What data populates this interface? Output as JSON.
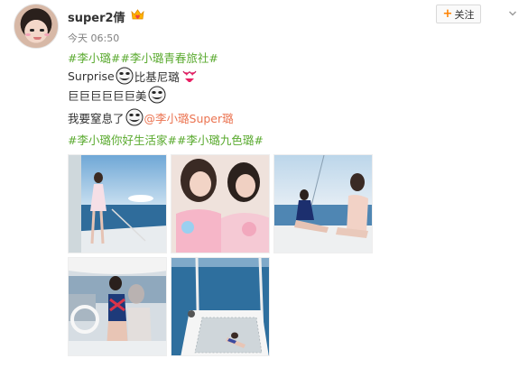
{
  "user": {
    "name": "super2倩",
    "time": "今天 06:50"
  },
  "follow": {
    "plus": "+",
    "label": "关注"
  },
  "post": {
    "line1": {
      "tag1": "#李小璐#",
      "tag2": "#李小璐青春旅社#"
    },
    "line2": {
      "text1": "Surprise",
      "text2": "比基尼璐"
    },
    "line3": {
      "text1": "巨巨巨巨巨巨美"
    },
    "line4": {
      "text1": "我要窒息了",
      "mention": "@李小璐Super璐"
    },
    "line5": {
      "tag1": "#李小璐你好生活家#",
      "tag2": "#李小璐九色璐#"
    }
  },
  "icons": {
    "vip": "crown-heart-icon",
    "chevron": "chevron-down-icon",
    "emoji_face": "troll-face-emoji",
    "emoji_bikini": "bikini-emoji"
  },
  "colors": {
    "tag": "#5aaa2f",
    "mention": "#eb7350",
    "follow_plus": "#ff8200"
  },
  "photos": [
    {
      "name": "photo-1"
    },
    {
      "name": "photo-2"
    },
    {
      "name": "photo-3"
    },
    {
      "name": "photo-4"
    },
    {
      "name": "photo-5"
    }
  ]
}
